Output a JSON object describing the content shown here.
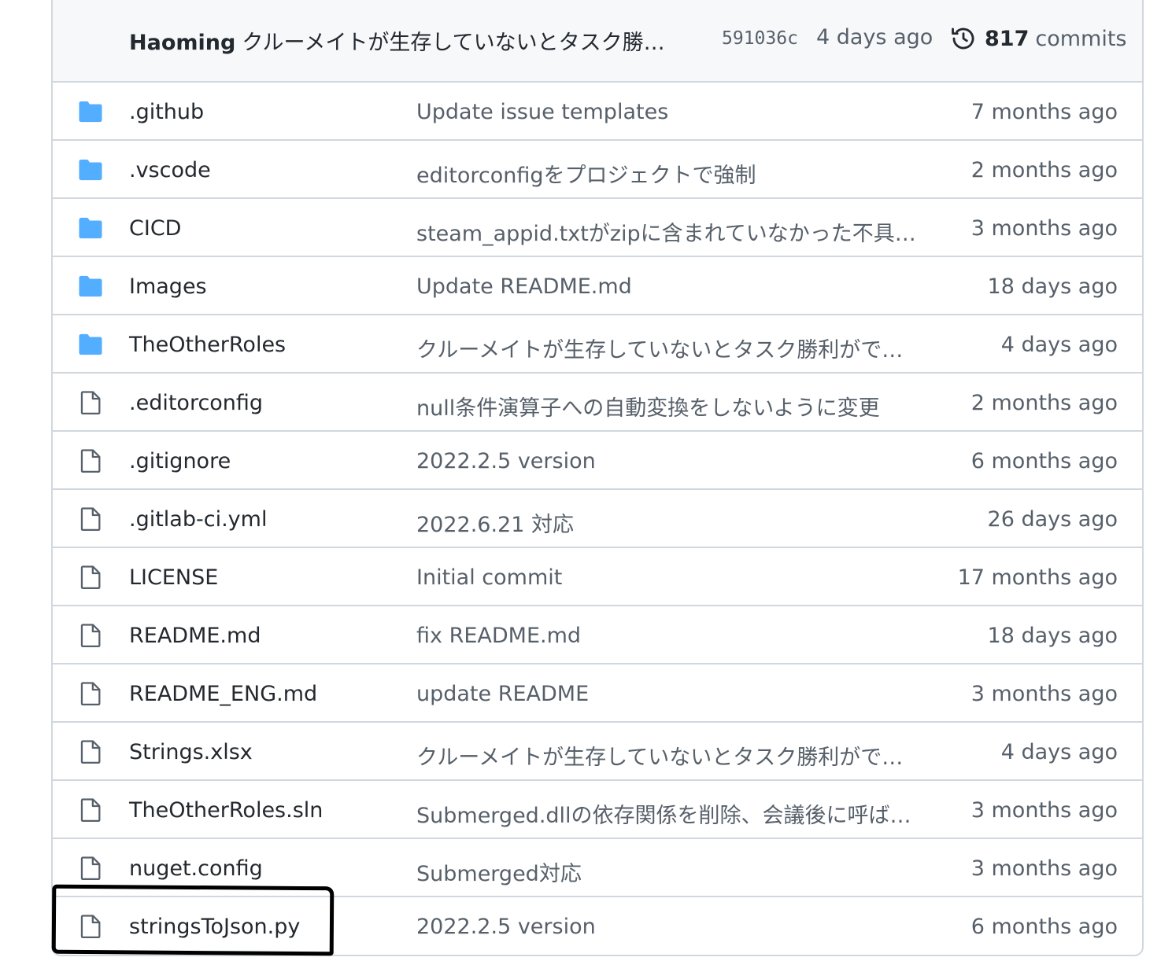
{
  "latest_commit": {
    "author": "Haoming",
    "message": "クルーメイトが生存していないとタスク勝…",
    "sha": "591036c",
    "time": "4 days ago",
    "commit_count": "817",
    "commit_label": "commits"
  },
  "files": [
    {
      "type": "folder",
      "icon": "folder-icon",
      "name": ".github",
      "message": "Update issue templates",
      "age": "7 months ago"
    },
    {
      "type": "folder",
      "icon": "folder-icon",
      "name": ".vscode",
      "message": "editorconfigをプロジェクトで強制",
      "age": "2 months ago"
    },
    {
      "type": "folder",
      "icon": "folder-icon",
      "name": "CICD",
      "message": "steam_appid.txtがzipに含まれていなかった不具…",
      "age": "3 months ago"
    },
    {
      "type": "folder",
      "icon": "folder-icon",
      "name": "Images",
      "message": "Update README.md",
      "age": "18 days ago"
    },
    {
      "type": "folder",
      "icon": "folder-icon",
      "name": "TheOtherRoles",
      "message": "クルーメイトが生存していないとタスク勝利がで…",
      "age": "4 days ago"
    },
    {
      "type": "file",
      "icon": "file-icon",
      "name": ".editorconfig",
      "message": "null条件演算子への自動変換をしないように変更",
      "age": "2 months ago"
    },
    {
      "type": "file",
      "icon": "file-icon",
      "name": ".gitignore",
      "message": "2022.2.5 version",
      "age": "6 months ago"
    },
    {
      "type": "file",
      "icon": "file-icon",
      "name": ".gitlab-ci.yml",
      "message": "2022.6.21 対応",
      "age": "26 days ago"
    },
    {
      "type": "file",
      "icon": "file-icon",
      "name": "LICENSE",
      "message": "Initial commit",
      "age": "17 months ago"
    },
    {
      "type": "file",
      "icon": "file-icon",
      "name": "README.md",
      "message": "fix README.md",
      "age": "18 days ago"
    },
    {
      "type": "file",
      "icon": "file-icon",
      "name": "README_ENG.md",
      "message": "update README",
      "age": "3 months ago"
    },
    {
      "type": "file",
      "icon": "file-icon",
      "name": "Strings.xlsx",
      "message": "クルーメイトが生存していないとタスク勝利がで…",
      "age": "4 days ago"
    },
    {
      "type": "file",
      "icon": "file-icon",
      "name": "TheOtherRoles.sln",
      "message": "Submerged.dllの依存関係を削除、会議後に呼ば…",
      "age": "3 months ago"
    },
    {
      "type": "file",
      "icon": "file-icon",
      "name": "nuget.config",
      "message": "Submerged対応",
      "age": "3 months ago"
    },
    {
      "type": "file",
      "icon": "file-icon",
      "name": "stringsToJson.py",
      "message": "2022.2.5 version",
      "age": "6 months ago"
    }
  ],
  "colors": {
    "folder": "#54aeff",
    "file_outline": "#57606a",
    "border": "#d0d7de",
    "header_bg": "#f6f8fa",
    "annotation": "#000000"
  }
}
